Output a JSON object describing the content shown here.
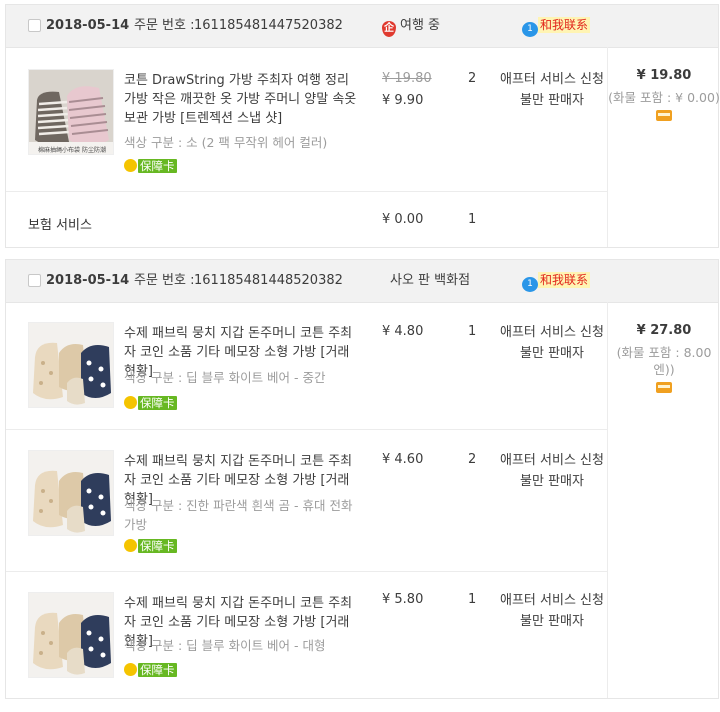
{
  "orders": [
    {
      "date": "2018-05-14",
      "order_label": "주문 번호 :",
      "order_number": "161185481447520382",
      "shop_name": "여행 중",
      "shop_icon": "tmall-shield-icon",
      "shop_icon_text": "企",
      "chat_icon_text": "1",
      "chat_label": "和我联系",
      "items": [
        {
          "title": "코튼 DrawString 가방 주최자 여행 정리 가방 작은 깨끗한 옷 가방 주머니 양말 속옷 보관 가방 [트렌젝션 스냅 샷]",
          "attr": "색상 구분 : 소 (2 팩 무작위 헤어 컬러)",
          "guarantee": "保障卡",
          "thumb_caption": "棉麻抽绳小布袋 防尘防潮",
          "original_price": "¥ 19.80",
          "price": "¥ 9.90",
          "qty": "2",
          "svc_line1": "애프터 서비스 신청",
          "svc_line2": "불만 판매자"
        }
      ],
      "insurance": {
        "label": "보험 서비스",
        "price": "¥ 0.00",
        "qty": "1"
      },
      "total": "¥ 19.80",
      "shipping": "(화물 포함 : ¥ 0.00)"
    },
    {
      "date": "2018-05-14",
      "order_label": "주문 번호 :",
      "order_number": "161185481448520382",
      "shop_name": "사오 판 백화점",
      "chat_icon_text": "1",
      "chat_label": "和我联系",
      "items": [
        {
          "title": "수제 패브릭 뭉치 지갑 돈주머니 코튼 주최자 코인 소품 기타 메모장 소형 가방 [거래 현황]",
          "attr": "색상 구분 : 딥 블루 화이트 베어 - 중간",
          "guarantee": "保障卡",
          "price": "¥ 4.80",
          "qty": "1",
          "svc_line1": "애프터 서비스 신청",
          "svc_line2": "불만 판매자"
        },
        {
          "title": "수제 패브릭 뭉치 지갑 돈주머니 코튼 주최자 코인 소품 기타 메모장 소형 가방 [거래 현황]",
          "attr": "색상 구분 : 진한 파란색 흰색 곰 - 휴대 전화 가방",
          "guarantee": "保障卡",
          "price": "¥ 4.60",
          "qty": "2",
          "svc_line1": "애프터 서비스 신청",
          "svc_line2": "불만 판매자"
        },
        {
          "title": "수제 패브릭 뭉치 지갑 돈주머니 코튼 주최자 코인 소품 기타 메모장 소형 가방 [거래 현황]",
          "attr": "색상 구분 : 딥 블루 화이트 베어 - 대형",
          "guarantee": "保障卡",
          "price": "¥ 5.80",
          "qty": "1",
          "svc_line1": "애프터 서비스 신청",
          "svc_line2": "불만 판매자"
        }
      ],
      "total": "¥ 27.80",
      "shipping": "(화물 포함 : 8.00 엔))"
    }
  ],
  "colors": {
    "header_bg": "#f2f2f2",
    "guarantee_green": "#67b822",
    "chat_red": "#e1251b",
    "chat_blue": "#2a96e8",
    "shop_red": "#e03a2f"
  }
}
